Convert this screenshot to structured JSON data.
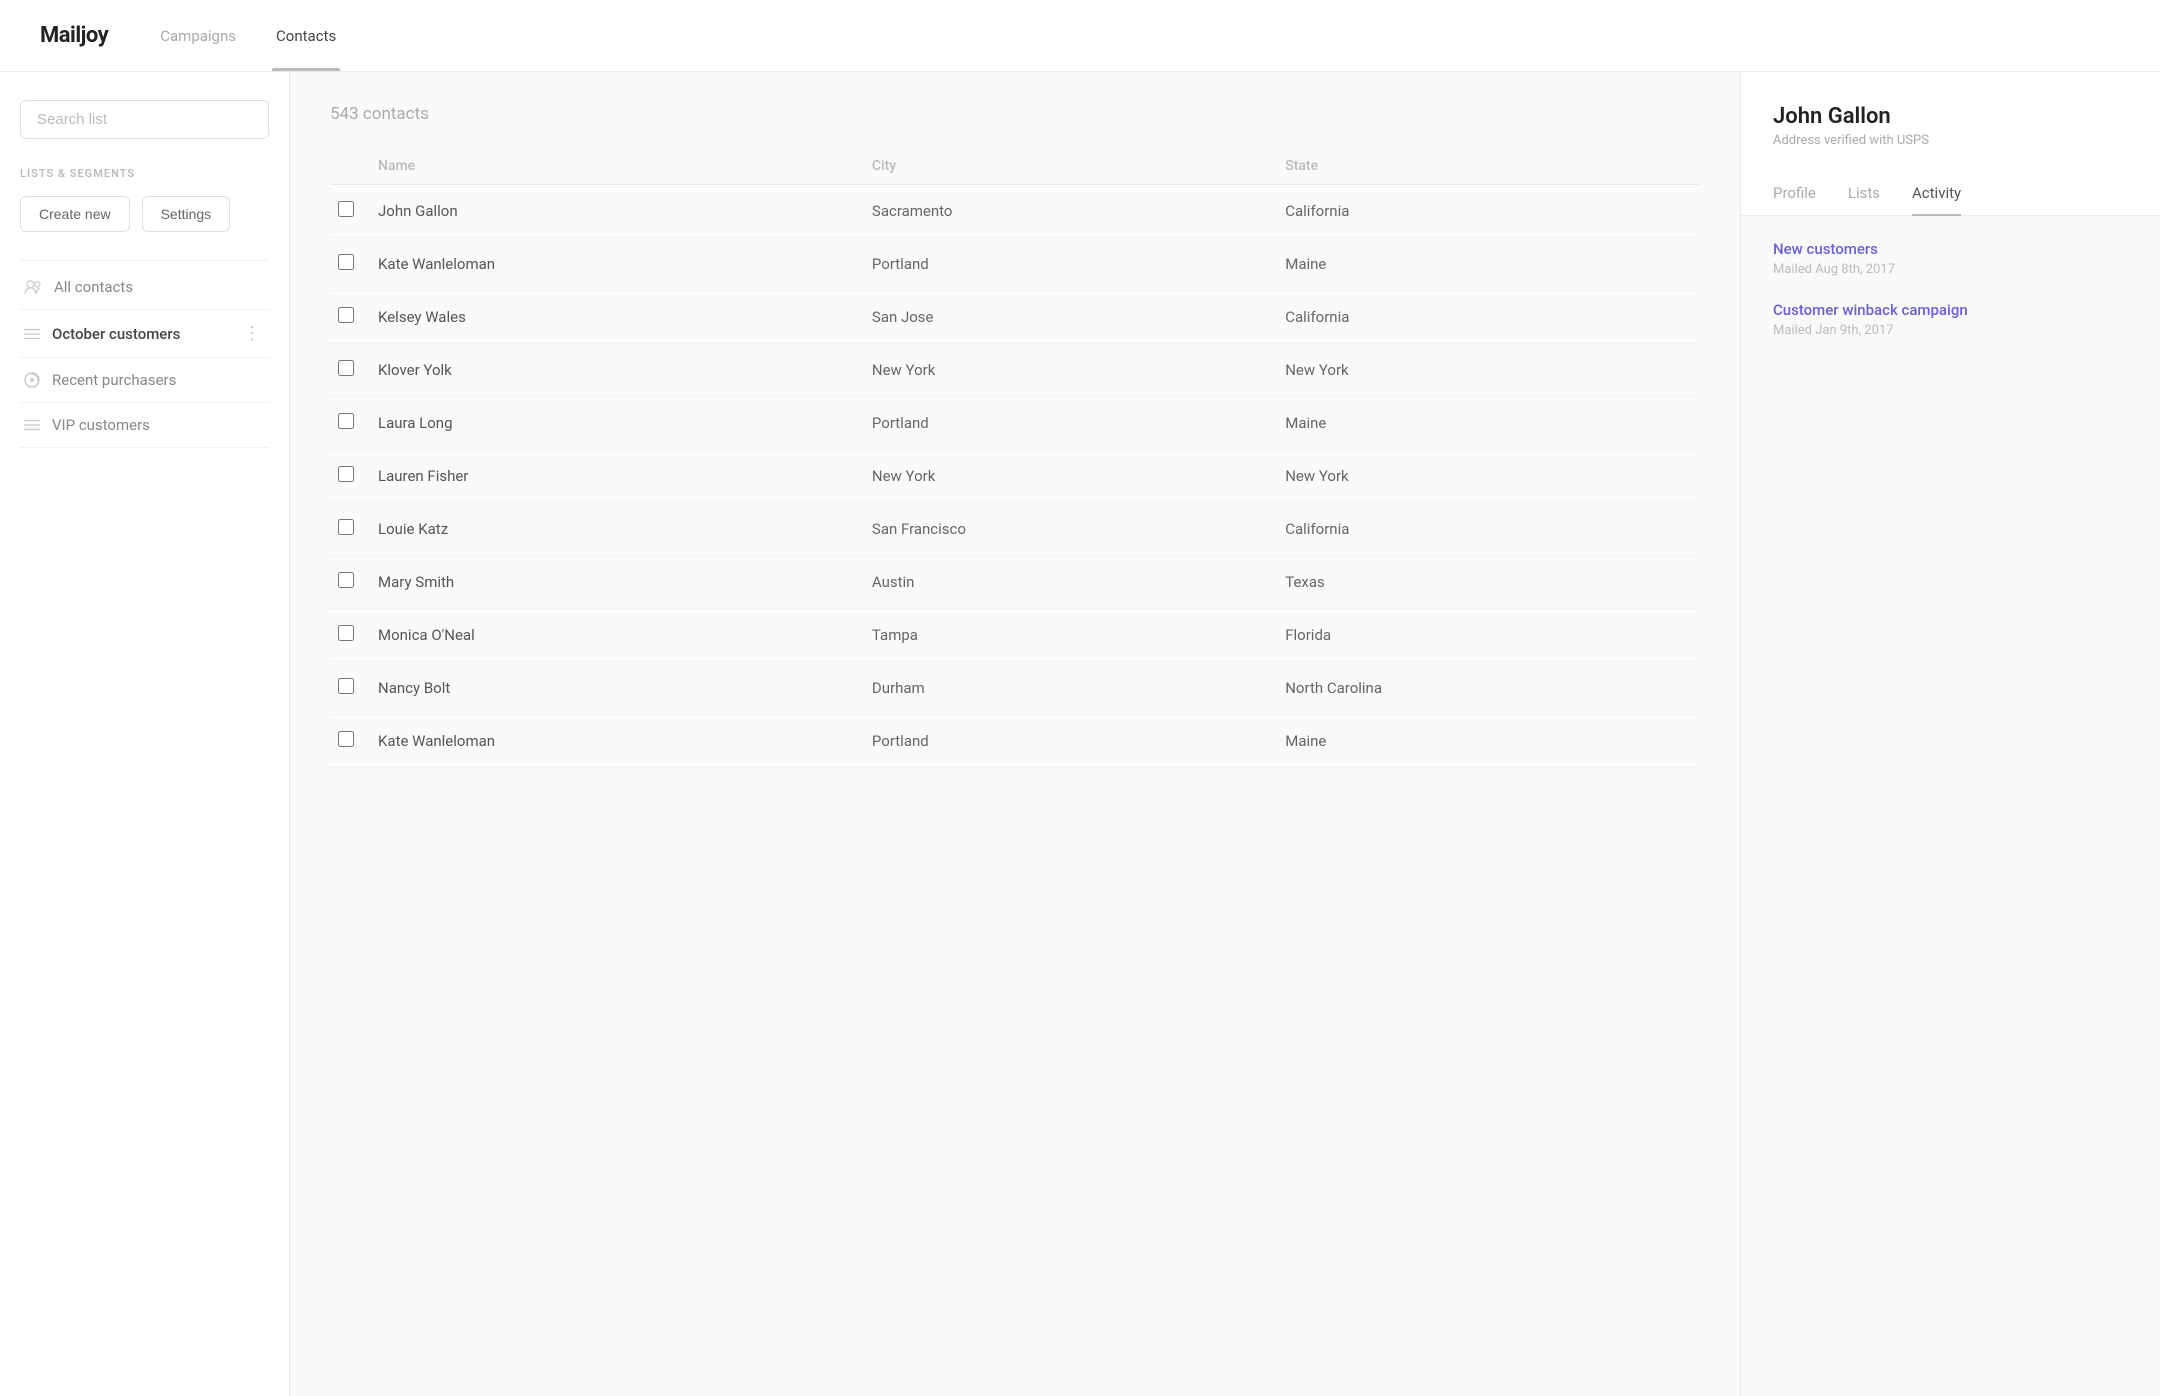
{
  "app": {
    "logo": "Mailjoy"
  },
  "nav": {
    "tabs": [
      {
        "id": "campaigns",
        "label": "Campaigns",
        "active": false
      },
      {
        "id": "contacts",
        "label": "Contacts",
        "active": true
      }
    ]
  },
  "sidebar": {
    "search_placeholder": "Search list",
    "section_label": "LISTS & SEGMENTS",
    "buttons": {
      "create": "Create new",
      "settings": "Settings"
    },
    "items": [
      {
        "id": "all-contacts",
        "label": "All contacts",
        "icon": "people",
        "active": false
      },
      {
        "id": "october-customers",
        "label": "October customers",
        "icon": "list",
        "active": true,
        "has_more": true
      },
      {
        "id": "recent-purchasers",
        "label": "Recent purchasers",
        "icon": "segment",
        "active": false
      },
      {
        "id": "vip-customers",
        "label": "VIP customers",
        "icon": "list",
        "active": false
      }
    ]
  },
  "contact_list": {
    "count_label": "543 contacts",
    "columns": [
      "Name",
      "City",
      "State"
    ],
    "rows": [
      {
        "name": "John Gallon",
        "city": "Sacramento",
        "state": "California"
      },
      {
        "name": "Kate Wanleloman",
        "city": "Portland",
        "state": "Maine"
      },
      {
        "name": "Kelsey Wales",
        "city": "San Jose",
        "state": "California"
      },
      {
        "name": "Klover Yolk",
        "city": "New York",
        "state": "New York"
      },
      {
        "name": "Laura Long",
        "city": "Portland",
        "state": "Maine"
      },
      {
        "name": "Lauren Fisher",
        "city": "New York",
        "state": "New York"
      },
      {
        "name": "Louie Katz",
        "city": "San Francisco",
        "state": "California"
      },
      {
        "name": "Mary Smith",
        "city": "Austin",
        "state": "Texas"
      },
      {
        "name": "Monica O'Neal",
        "city": "Tampa",
        "state": "Florida"
      },
      {
        "name": "Nancy Bolt",
        "city": "Durham",
        "state": "North Carolina"
      },
      {
        "name": "Kate Wanleloman",
        "city": "Portland",
        "state": "Maine"
      }
    ]
  },
  "right_panel": {
    "contact_name": "John Gallon",
    "contact_subtitle": "Address verified with USPS",
    "tabs": [
      {
        "id": "profile",
        "label": "Profile",
        "active": false
      },
      {
        "id": "lists",
        "label": "Lists",
        "active": false
      },
      {
        "id": "activity",
        "label": "Activity",
        "active": true
      }
    ],
    "campaigns": [
      {
        "id": "new-customers",
        "title": "New customers",
        "date": "Mailed Aug 8th, 2017"
      },
      {
        "id": "customer-winback",
        "title": "Customer winback campaign",
        "date": "Mailed Jan 9th, 2017"
      }
    ]
  }
}
